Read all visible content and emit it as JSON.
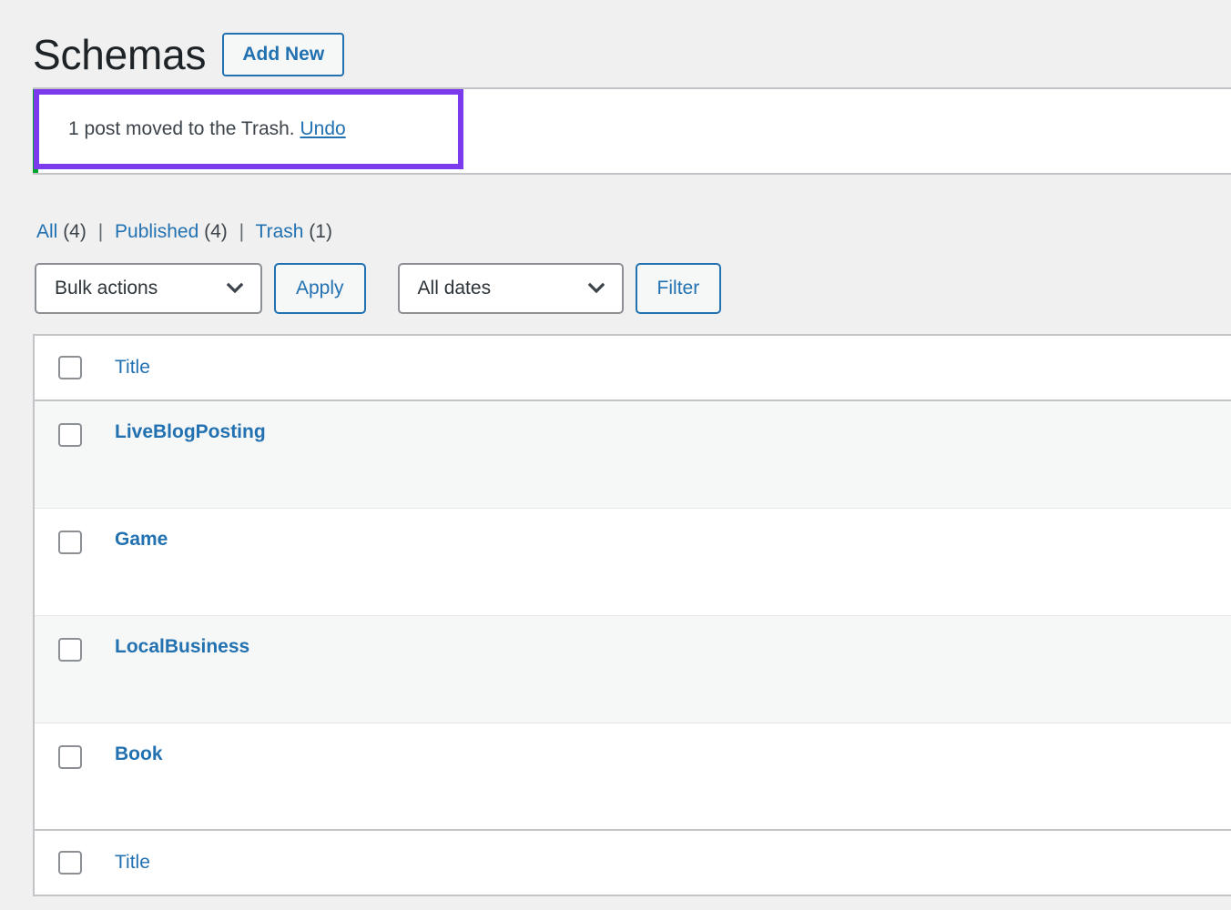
{
  "header": {
    "title": "Schemas",
    "add_new_label": "Add New"
  },
  "notice": {
    "message": "1 post moved to the Trash.",
    "undo_label": "Undo",
    "accent_color": "#00a32d",
    "focus_color": "#7c3aed"
  },
  "status_links": {
    "all": {
      "label": "All",
      "count": "(4)"
    },
    "published": {
      "label": "Published",
      "count": "(4)"
    },
    "trash": {
      "label": "Trash",
      "count": "(1)"
    },
    "separator": "|"
  },
  "toolbar": {
    "bulk_actions_value": "Bulk actions",
    "apply_label": "Apply",
    "dates_value": "All dates",
    "filter_label": "Filter"
  },
  "table": {
    "column_title": "Title",
    "footer_column_title": "Title",
    "rows": [
      {
        "title": "LiveBlogPosting"
      },
      {
        "title": "Game"
      },
      {
        "title": "LocalBusiness"
      },
      {
        "title": "Book"
      }
    ]
  },
  "colors": {
    "link_blue": "#2271b1",
    "page_bg": "#f0f0f1",
    "row_alt_bg": "#f6f7f7",
    "text_dark": "#1d2327"
  }
}
